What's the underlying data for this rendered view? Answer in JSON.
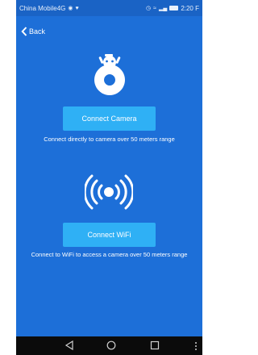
{
  "status_bar": {
    "carrier": "China Mobile4G",
    "time": "2:20 F",
    "carrier_icons": [
      "notification-icon",
      "heart-rate-icon"
    ],
    "right_icons": [
      "alarm-icon",
      "wifi-signal-icon",
      "cell-signal-icon",
      "battery-icon"
    ]
  },
  "header": {
    "back_label": "Back"
  },
  "camera": {
    "button_label": "Connect Camera",
    "description": "Connect directly to camera over 50 meters range"
  },
  "wifi": {
    "button_label": "Connect WiFi",
    "description": "Connect to WiFi to access a camera over 50 meters range"
  },
  "colors": {
    "background": "#1d6fd8",
    "button": "#2fb0f5",
    "text": "#ffffff",
    "nav_bar": "#0b0b0b"
  }
}
